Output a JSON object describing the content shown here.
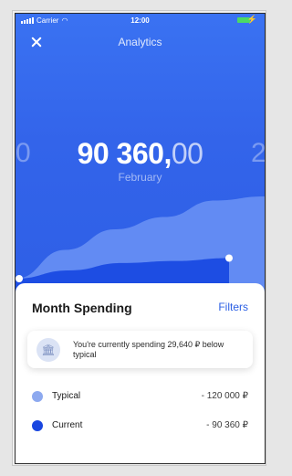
{
  "status_bar": {
    "carrier": "Carrier",
    "time": "12:00"
  },
  "header": {
    "title": "Analytics"
  },
  "summary": {
    "amount_integer": "90 360,",
    "amount_cents": "00",
    "prev_amount_partial": "0",
    "next_amount_partial": "2",
    "month": "February"
  },
  "chart_data": {
    "type": "area",
    "series": [
      {
        "values": [
          0.0,
          0.35,
          0.6,
          0.75,
          0.95,
          1.0
        ]
      },
      {
        "values": [
          0.0,
          0.2,
          0.38,
          0.43,
          0.5
        ]
      }
    ],
    "colors": {
      "typical": "#6b93f5",
      "current": "#1d4de3"
    }
  },
  "sheet": {
    "title": "Month Spending",
    "filters_label": "Filters",
    "info_text": "You're currently spending 29,640 ₽ below typical",
    "legend": [
      {
        "label": "Typical",
        "value": "- 120 000 ₽",
        "color": "#8da9ef"
      },
      {
        "label": "Current",
        "value": "- 90 360 ₽",
        "color": "#1946e0"
      }
    ]
  },
  "icons": {
    "close": "close-icon",
    "bank": "bank-icon"
  }
}
